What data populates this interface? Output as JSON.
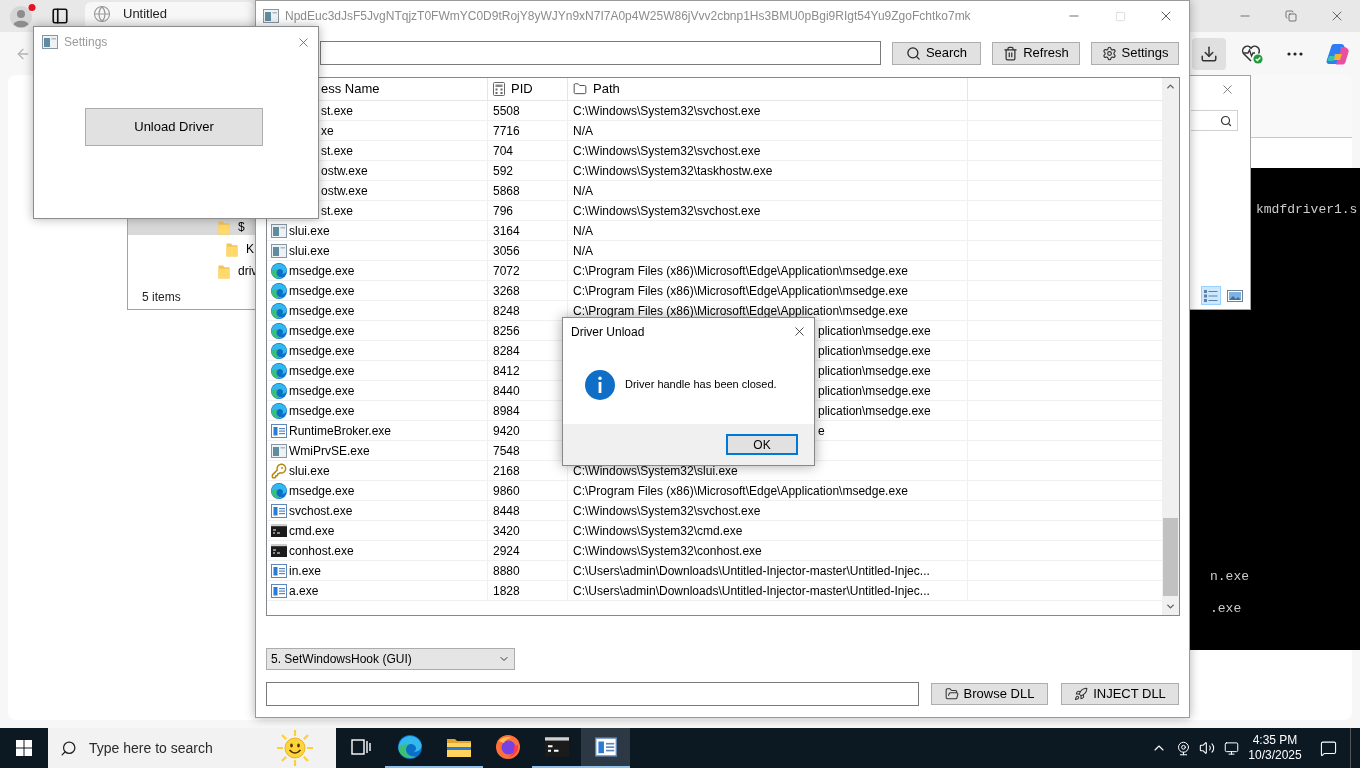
{
  "browser": {
    "tab": {
      "title": "Untitled"
    },
    "toolbar_buttons": [
      {
        "kind": "download",
        "selected": true
      },
      {
        "kind": "health",
        "selected": false
      },
      {
        "kind": "more",
        "selected": false
      },
      {
        "kind": "copilot",
        "selected": false
      }
    ]
  },
  "terminal": {
    "top_lines": [
      "kmdfdriver1.s"
    ],
    "bottom_lines": [
      "n.exe",
      ".exe"
    ]
  },
  "explorer": {
    "tree": [
      {
        "name": "$",
        "selected": true,
        "children": [
          {
            "name": "K",
            "selected": false
          }
        ]
      },
      {
        "name": "driv",
        "selected": false
      }
    ],
    "status": "5 items",
    "view_buttons": [
      {
        "kind": "details",
        "selected": true
      },
      {
        "kind": "preview",
        "selected": false
      }
    ]
  },
  "main_window": {
    "title": "NpdEuc3dJsF5JvgNTqjzT0FWmYC0D9tRojY8yWJYn9xN7I7A0p4W25W86jVvv2cbnp1Hs3BMU0pBgi9RIgt54Yu9ZgoFchtko7mk",
    "window_controls": [
      {
        "kind": "minimize",
        "disabled": false
      },
      {
        "kind": "maximize",
        "disabled": true
      },
      {
        "kind": "close",
        "disabled": false
      }
    ],
    "toolbar_buttons": [
      {
        "label": "Search",
        "kind": "search"
      },
      {
        "label": "Refresh",
        "kind": "refresh"
      },
      {
        "label": "Settings",
        "kind": "settings"
      }
    ],
    "table": {
      "columns": [
        {
          "label": "ess Name",
          "kind": "covered"
        },
        {
          "label": "PID",
          "kind": "number"
        },
        {
          "label": "Path",
          "kind": "folder"
        }
      ],
      "rows": [
        {
          "kind": "covered",
          "name": "st.exe",
          "pid": "5508",
          "path": "C:\\Windows\\System32\\svchost.exe"
        },
        {
          "kind": "covered",
          "name": "xe",
          "pid": "7716",
          "path": "N/A"
        },
        {
          "kind": "covered",
          "name": "st.exe",
          "pid": "704",
          "path": "C:\\Windows\\System32\\svchost.exe"
        },
        {
          "kind": "covered",
          "name": "ostw.exe",
          "pid": "592",
          "path": "C:\\Windows\\System32\\taskhostw.exe"
        },
        {
          "kind": "covered",
          "name": "ostw.exe",
          "pid": "5868",
          "path": "N/A"
        },
        {
          "kind": "covered",
          "name": "st.exe",
          "pid": "796",
          "path": "C:\\Windows\\System32\\svchost.exe"
        },
        {
          "kind": "app",
          "name": "slui.exe",
          "pid": "3164",
          "path": "N/A"
        },
        {
          "kind": "app",
          "name": "slui.exe",
          "pid": "3056",
          "path": "N/A"
        },
        {
          "kind": "edge",
          "name": "msedge.exe",
          "pid": "7072",
          "path": "C:\\Program Files (x86)\\Microsoft\\Edge\\Application\\msedge.exe"
        },
        {
          "kind": "edge",
          "name": "msedge.exe",
          "pid": "3268",
          "path": "C:\\Program Files (x86)\\Microsoft\\Edge\\Application\\msedge.exe"
        },
        {
          "kind": "edge",
          "name": "msedge.exe",
          "pid": "8248",
          "path": "C:\\Program Files (x86)\\Microsoft\\Edge\\Application\\msedge.exe"
        },
        {
          "kind": "edge",
          "name": "msedge.exe",
          "pid": "8256",
          "path_end": "plication\\msedge.exe"
        },
        {
          "kind": "edge",
          "name": "msedge.exe",
          "pid": "8284",
          "path_end": "plication\\msedge.exe"
        },
        {
          "kind": "edge",
          "name": "msedge.exe",
          "pid": "8412",
          "path_end": "plication\\msedge.exe"
        },
        {
          "kind": "edge",
          "name": "msedge.exe",
          "pid": "8440",
          "path_end": "plication\\msedge.exe"
        },
        {
          "kind": "edge",
          "name": "msedge.exe",
          "pid": "8984",
          "path_end": "plication\\msedge.exe"
        },
        {
          "kind": "service",
          "name": "RuntimeBroker.exe",
          "pid": "9420",
          "path_end": "e"
        },
        {
          "kind": "app",
          "name": "WmiPrvSE.exe",
          "pid": "7548"
        },
        {
          "kind": "key",
          "name": "slui.exe",
          "pid": "2168",
          "path": "C:\\Windows\\System32\\slui.exe"
        },
        {
          "kind": "edge",
          "name": "msedge.exe",
          "pid": "9860",
          "path": "C:\\Program Files (x86)\\Microsoft\\Edge\\Application\\msedge.exe"
        },
        {
          "kind": "service",
          "name": "svchost.exe",
          "pid": "8448",
          "path": "C:\\Windows\\System32\\svchost.exe"
        },
        {
          "kind": "console",
          "name": "cmd.exe",
          "pid": "3420",
          "path": "C:\\Windows\\System32\\cmd.exe"
        },
        {
          "kind": "console",
          "name": "conhost.exe",
          "pid": "2924",
          "path": "C:\\Windows\\System32\\conhost.exe"
        },
        {
          "kind": "service",
          "name": "in.exe",
          "pid": "8880",
          "path": "C:\\Users\\admin\\Downloads\\Untitled-Injector-master\\Untitled-Injec..."
        },
        {
          "kind": "service",
          "name": "a.exe",
          "pid": "1828",
          "path": "C:\\Users\\admin\\Downloads\\Untitled-Injector-master\\Untitled-Injec..."
        }
      ]
    },
    "method_dropdown": {
      "value": "5. SetWindowsHook (GUI)"
    },
    "action_buttons": [
      {
        "label": "Browse DLL",
        "kind": "browse"
      },
      {
        "label": "INJECT DLL",
        "kind": "inject"
      }
    ]
  },
  "settings_window": {
    "title": "Settings",
    "button": "Unload Driver"
  },
  "dialog": {
    "title": "Driver Unload",
    "message": "Driver handle has been closed.",
    "button": "OK"
  },
  "taskbar": {
    "search": {
      "placeholder": "Type here to search"
    },
    "apps": [
      {
        "kind": "task-view",
        "running": false,
        "active": false
      },
      {
        "kind": "edge",
        "running": true,
        "active": false
      },
      {
        "kind": "explorer",
        "running": true,
        "active": false
      },
      {
        "kind": "firefox",
        "running": false,
        "active": false
      },
      {
        "kind": "terminal",
        "running": true,
        "active": false
      },
      {
        "kind": "app",
        "running": true,
        "active": true
      }
    ],
    "time": "4:35 PM",
    "date": "10/3/2025"
  }
}
